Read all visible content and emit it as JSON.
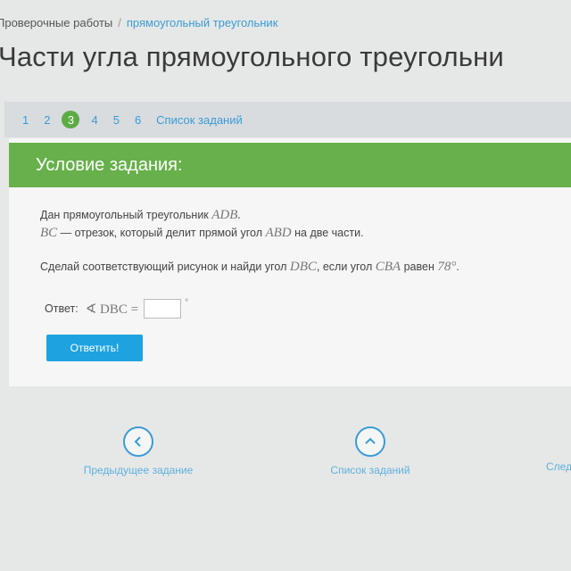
{
  "breadcrumb": {
    "home": "Проверочные работы",
    "separator": "/",
    "current": "прямоугольный треугольник"
  },
  "page_title": "Части угла прямоугольного треугольни",
  "tabs": [
    {
      "label": "1",
      "active": false
    },
    {
      "label": "2",
      "active": false
    },
    {
      "label": "3",
      "active": true
    },
    {
      "label": "4",
      "active": false
    },
    {
      "label": "5",
      "active": false
    },
    {
      "label": "6",
      "active": false
    },
    {
      "label": "Список заданий",
      "active": false
    }
  ],
  "condition": {
    "header": "Условие задания:",
    "line1_text": "Дан прямоугольный треугольник ",
    "line1_math": "ADB.",
    "line2_math1": "BC",
    "line2_text1": " — отрезок, который делит прямой угол ",
    "line2_math2": "ABD",
    "line2_text2": " на две части.",
    "line3_text1": "Сделай соответствующий рисунок и найди угол ",
    "line3_math1": "DBC",
    "line3_text2": ", если угол ",
    "line3_math2": "CBA",
    "line3_text3": " равен ",
    "line3_math3": "78°",
    "line3_text4": "."
  },
  "answer": {
    "label": "Ответ:",
    "expression": "∢ DBC =",
    "value": "",
    "unit": "°"
  },
  "submit_label": "Ответить!",
  "navigation": {
    "prev_label": "Предыдущее задание",
    "list_label": "Список заданий",
    "next_label": "След"
  },
  "colors": {
    "accent_green": "#67b04b",
    "link_blue": "#3a9bd5",
    "button_blue": "#1ea3e0"
  },
  "icons": {
    "prev": "chevron-left-icon",
    "list": "chevron-up-icon"
  }
}
